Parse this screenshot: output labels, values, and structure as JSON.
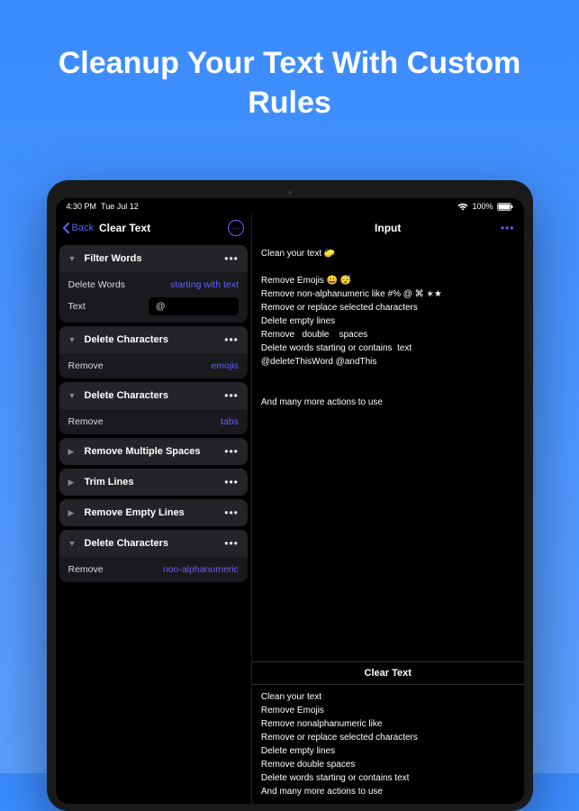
{
  "headline": "Cleanup Your Text With Custom Rules",
  "statusBar": {
    "time": "4:30 PM",
    "date": "Tue Jul 12",
    "battery": "100%"
  },
  "nav": {
    "back": "Back",
    "title": "Clear Text"
  },
  "rules": [
    {
      "title": "Filter Words",
      "expanded": true,
      "rows": [
        {
          "label": "Delete Words",
          "value": "starting with text",
          "type": "value"
        },
        {
          "label": "Text",
          "value": "@",
          "type": "input"
        }
      ]
    },
    {
      "title": "Delete Characters",
      "expanded": true,
      "rows": [
        {
          "label": "Remove",
          "value": "emojis",
          "type": "value"
        }
      ]
    },
    {
      "title": "Delete Characters",
      "expanded": true,
      "rows": [
        {
          "label": "Remove",
          "value": "tabs",
          "type": "value"
        }
      ]
    },
    {
      "title": "Remove Multiple Spaces",
      "expanded": false,
      "rows": []
    },
    {
      "title": "Trim Lines",
      "expanded": false,
      "rows": []
    },
    {
      "title": "Remove Empty Lines",
      "expanded": false,
      "rows": []
    },
    {
      "title": "Delete Characters",
      "expanded": true,
      "rows": [
        {
          "label": "Remove",
          "value": "non-alphanumeric",
          "type": "value"
        }
      ]
    }
  ],
  "input": {
    "title": "Input",
    "text": "Clean your text 🧽\n\nRemove Emojis 😀 😴\nRemove non-alphanumeric like #% @ ⌘ ∗★\nRemove or replace selected characters\nDelete empty lines\nRemove   double    spaces\nDelete words starting or contains  text\n@deleteThisWord @andThis\n\n\nAnd many more actions to use"
  },
  "output": {
    "title": "Clear Text",
    "text": "Clean your text\nRemove Emojis\nRemove nonalphanumeric like\nRemove or replace selected characters\nDelete empty lines\nRemove double spaces\nDelete words starting or contains text\nAnd many more actions to use"
  }
}
